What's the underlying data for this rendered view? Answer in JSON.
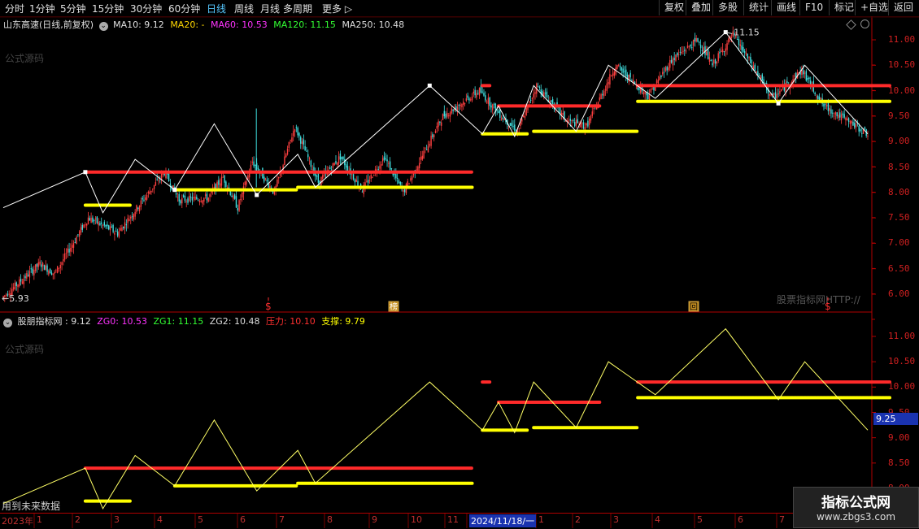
{
  "toolbar": {
    "periods": [
      "分时",
      "1分钟",
      "5分钟",
      "15分钟",
      "30分钟",
      "60分钟",
      "日线",
      "周线",
      "月线",
      "多周期",
      "更多 ▷"
    ],
    "active_period": "日线",
    "right_buttons": [
      "复权",
      "叠加",
      "多股",
      "统计",
      "画线",
      "F10",
      "标记",
      "+自选",
      "返回"
    ]
  },
  "main_legend": {
    "stock": "山东高速(日线,前复权)",
    "ma10": "MA10: 9.12",
    "ma20": "MA20: -",
    "ma60": "MA60: 10.53",
    "ma120": "MA120: 11.15",
    "ma250": "MA250: 10.48"
  },
  "sub_legend": {
    "name": "股朋指标网",
    "value": ": 9.12",
    "zg0": "ZG0: 10.53",
    "zg1": "ZG1: 11.15",
    "zg2": "ZG2: 10.48",
    "pressure": "压力: 10.10",
    "support": "支撑: 9.79"
  },
  "watermarks": {
    "main": "公式源码",
    "sub": "公式源码",
    "site_text": "股票指标网HTTP://",
    "future_data": "用到未来数据",
    "footer_logo_title": "指标公式网",
    "footer_logo_url": "www.zbgs3.com"
  },
  "annotations": {
    "high": "11.15",
    "low": "5.93",
    "marker_rank": "榜",
    "marker_return": "回",
    "marker_dollar": "$"
  },
  "y_axis_main": [
    "11.00",
    "10.50",
    "10.00",
    "9.50",
    "9.00",
    "8.50",
    "8.00",
    "7.50",
    "7.00",
    "6.50",
    "6.00"
  ],
  "y_axis_sub": [
    "11.00",
    "10.50",
    "10.00",
    "9.50",
    "9.00",
    "8.50",
    "8.00"
  ],
  "current_value_label": "9.25",
  "x_axis": {
    "year": "2023年",
    "months_a": [
      "1",
      "2",
      "3",
      "4",
      "5",
      "6",
      "7",
      "8",
      "9",
      "10",
      "11"
    ],
    "date_highlight": "2024/11/18/一",
    "months_b": [
      "1",
      "2",
      "3",
      "4",
      "5",
      "6",
      "7"
    ]
  },
  "chart_data": {
    "type": "line",
    "y_range_main": [
      5.85,
      11.25
    ],
    "y_range_sub": [
      7.85,
      11.2
    ],
    "zigzag": [
      {
        "d": 0,
        "y": 7.7
      },
      {
        "d": 56,
        "y": 8.4
      },
      {
        "d": 68,
        "y": 7.6
      },
      {
        "d": 90,
        "y": 8.65
      },
      {
        "d": 117,
        "y": 8.05
      },
      {
        "d": 144,
        "y": 9.35
      },
      {
        "d": 173,
        "y": 7.95
      },
      {
        "d": 201,
        "y": 8.75
      },
      {
        "d": 213,
        "y": 8.1
      },
      {
        "d": 291,
        "y": 10.1
      },
      {
        "d": 327,
        "y": 9.15
      },
      {
        "d": 338,
        "y": 9.7
      },
      {
        "d": 349,
        "y": 9.1
      },
      {
        "d": 362,
        "y": 10.1
      },
      {
        "d": 391,
        "y": 9.2
      },
      {
        "d": 413,
        "y": 10.5
      },
      {
        "d": 445,
        "y": 9.85
      },
      {
        "d": 493,
        "y": 11.15
      },
      {
        "d": 529,
        "y": 9.75
      },
      {
        "d": 547,
        "y": 10.5
      },
      {
        "d": 590,
        "y": 9.15
      }
    ],
    "resistance_segments": [
      {
        "d0": 56,
        "d1": 320,
        "y": 8.4
      },
      {
        "d0": 327,
        "d1": 332,
        "y": 10.1
      },
      {
        "d0": 338,
        "d1": 407,
        "y": 9.7
      },
      {
        "d0": 433,
        "d1": 605,
        "y": 10.1
      }
    ],
    "support_segments": [
      {
        "d0": 56,
        "d1": 87,
        "y": 7.75
      },
      {
        "d0": 117,
        "d1": 200,
        "y": 8.05
      },
      {
        "d0": 201,
        "d1": 320,
        "y": 8.1
      },
      {
        "d0": 327,
        "d1": 358,
        "y": 9.15
      },
      {
        "d0": 362,
        "d1": 433,
        "y": 9.2
      },
      {
        "d0": 433,
        "d1": 605,
        "y": 9.79
      }
    ],
    "candles_anchor": [
      {
        "d": 0,
        "y": 5.95
      },
      {
        "d": 25,
        "y": 6.6
      },
      {
        "d": 35,
        "y": 6.4
      },
      {
        "d": 58,
        "y": 7.5
      },
      {
        "d": 78,
        "y": 7.2
      },
      {
        "d": 110,
        "y": 8.4
      },
      {
        "d": 120,
        "y": 7.85
      },
      {
        "d": 140,
        "y": 7.9
      },
      {
        "d": 150,
        "y": 8.3
      },
      {
        "d": 160,
        "y": 7.7
      },
      {
        "d": 170,
        "y": 8.6
      },
      {
        "d": 185,
        "y": 8.0
      },
      {
        "d": 199,
        "y": 9.3
      },
      {
        "d": 215,
        "y": 8.2
      },
      {
        "d": 230,
        "y": 8.7
      },
      {
        "d": 245,
        "y": 8.05
      },
      {
        "d": 260,
        "y": 8.7
      },
      {
        "d": 273,
        "y": 8.0
      },
      {
        "d": 300,
        "y": 9.5
      },
      {
        "d": 325,
        "y": 10.0
      },
      {
        "d": 340,
        "y": 9.5
      },
      {
        "d": 351,
        "y": 9.2
      },
      {
        "d": 364,
        "y": 10.1
      },
      {
        "d": 385,
        "y": 9.4
      },
      {
        "d": 398,
        "y": 9.3
      },
      {
        "d": 418,
        "y": 10.5
      },
      {
        "d": 440,
        "y": 9.9
      },
      {
        "d": 456,
        "y": 10.6
      },
      {
        "d": 474,
        "y": 11.0
      },
      {
        "d": 484,
        "y": 10.5
      },
      {
        "d": 498,
        "y": 11.1
      },
      {
        "d": 525,
        "y": 9.85
      },
      {
        "d": 545,
        "y": 10.4
      },
      {
        "d": 560,
        "y": 9.7
      },
      {
        "d": 590,
        "y": 9.15
      }
    ],
    "colors": {
      "resistance": "#ff2a2a",
      "support": "#ffff00",
      "zigzag": "#ffff66",
      "up_candle": "#ff4040",
      "down_candle": "#40e0e0",
      "axis": "#b00000"
    }
  }
}
